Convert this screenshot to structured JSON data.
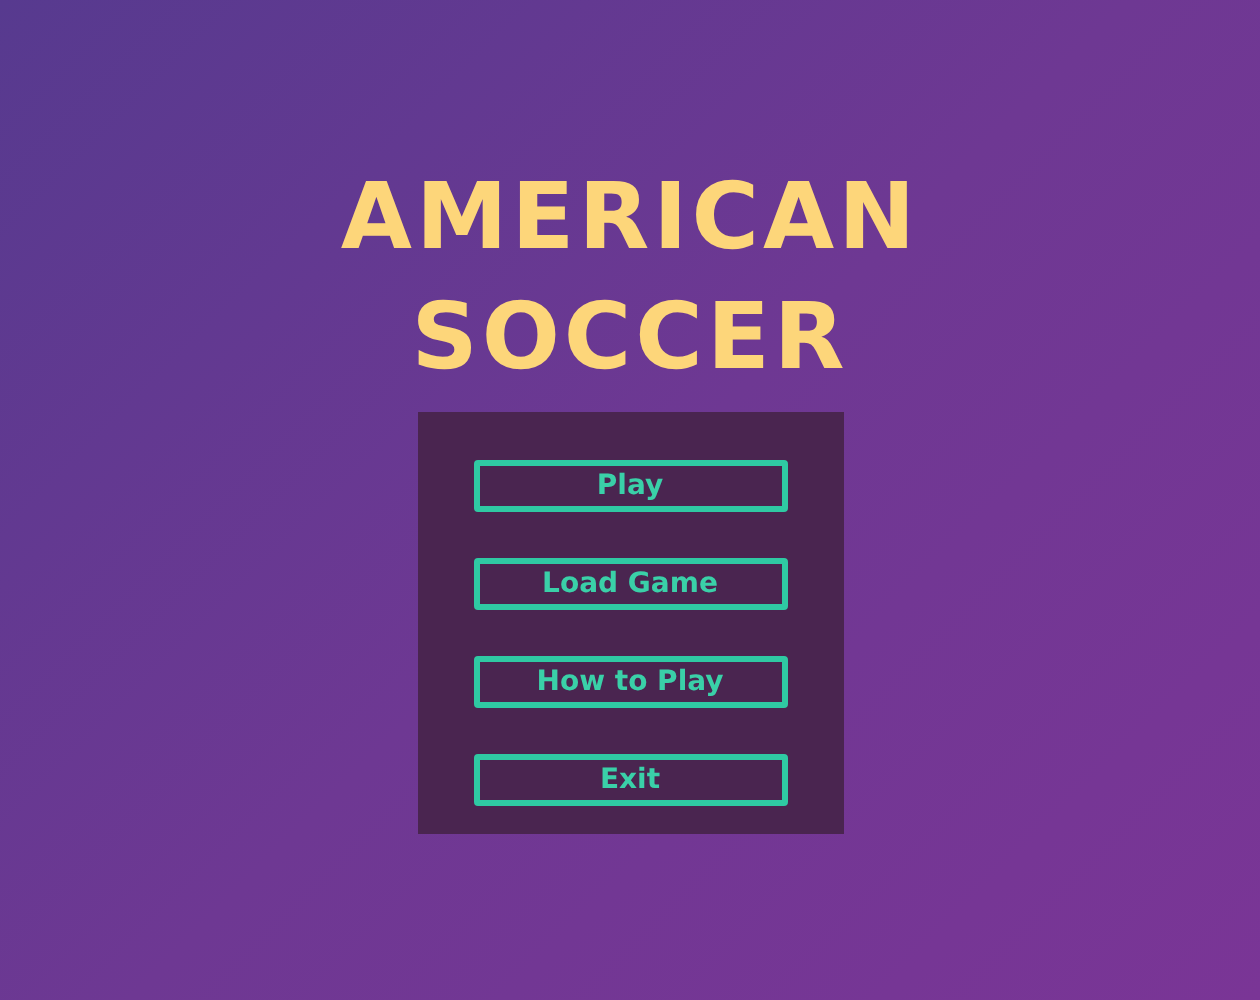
{
  "title_lines": [
    "AMERICAN",
    "SOCCER"
  ],
  "menu_buttons": [
    {
      "label": "Play"
    },
    {
      "label": "Load Game"
    },
    {
      "label": "How to Play"
    },
    {
      "label": "Exit"
    }
  ]
}
